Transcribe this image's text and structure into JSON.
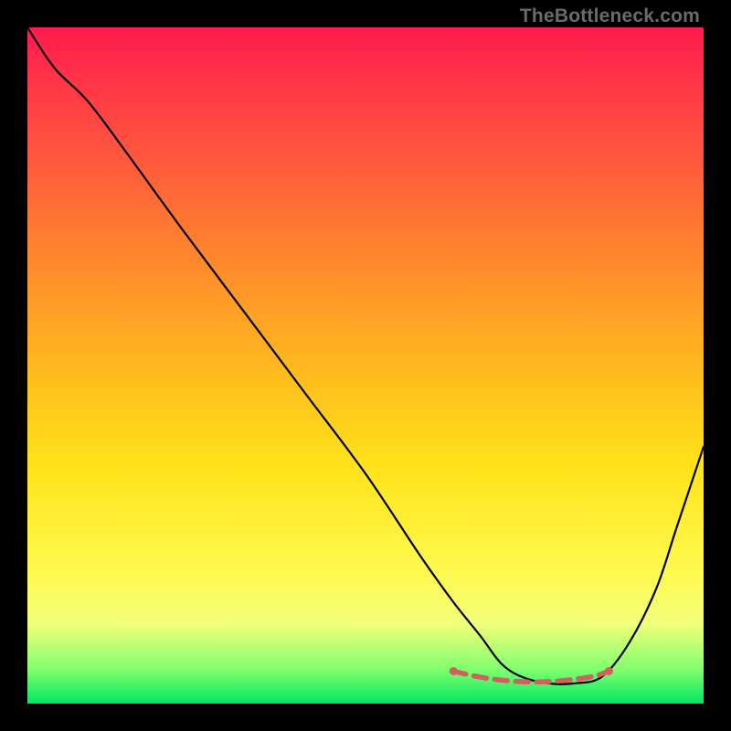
{
  "watermark": "TheBottleneck.com",
  "colors": {
    "markers": "#d1605e",
    "curve": "#000000",
    "background_gradient_top": "#ff1a4d",
    "background_gradient_bottom": "#00e861"
  },
  "chart_data": {
    "type": "line",
    "title": "",
    "xlabel": "",
    "ylabel": "",
    "xlim": [
      0,
      100
    ],
    "ylim": [
      0,
      100
    ],
    "grid": false,
    "legend_position": "none",
    "note": "V-shaped bottleneck curve over rainbow gradient; axis ticks not labeled, values estimated from pixel positions on a 0-100 normalized scale.",
    "series": [
      {
        "name": "bottleneck-curve",
        "x": [
          0,
          4,
          9,
          15,
          23,
          32,
          41,
          50,
          58,
          63,
          67,
          70,
          73,
          77,
          81,
          85,
          89,
          93,
          96,
          100
        ],
        "y": [
          100,
          94,
          89,
          81,
          70,
          58,
          46,
          34,
          22,
          15,
          10,
          6,
          4,
          3,
          3,
          4,
          9,
          17,
          26,
          38
        ]
      }
    ],
    "markers": {
      "name": "highlighted-minimum",
      "x": [
        63,
        66,
        69,
        72,
        75,
        78,
        81,
        84,
        86
      ],
      "y": [
        4.8,
        4.1,
        3.6,
        3.3,
        3.2,
        3.3,
        3.6,
        4.1,
        4.8
      ]
    }
  }
}
